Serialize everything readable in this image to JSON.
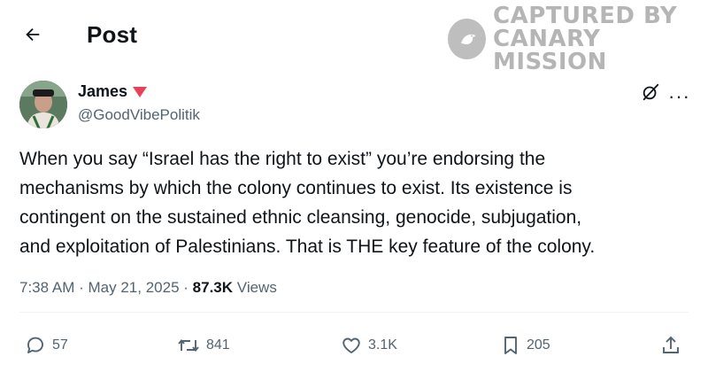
{
  "header": {
    "title": "Post",
    "back_icon": "arrow-left-icon"
  },
  "watermark": {
    "line1": "CAPTURED BY",
    "line2": "CANARY MISSION",
    "icon": "canary-bird-icon"
  },
  "post": {
    "author": {
      "name": "James",
      "handle": "@GoodVibePolitik",
      "badge_color": "#e8425b"
    },
    "text_lines": [
      "When you say “Israel has the right to exist” you’re endorsing the",
      "mechanisms by which the colony continues to exist. Its existence is",
      "contingent on the sustained ethnic cleansing, genocide, subjugation,",
      "and exploitation of Palestinians. That is THE key feature of the colony."
    ],
    "time": "7:38 AM",
    "date": "May 21, 2025",
    "separator": "·",
    "views_count": "87.3K",
    "views_label": "Views"
  },
  "actions": {
    "replies": "57",
    "reposts": "841",
    "likes": "3.1K",
    "bookmarks": "205"
  },
  "colors": {
    "text_primary": "#0f1419",
    "text_secondary": "#536471",
    "divider": "#eff3f4"
  }
}
